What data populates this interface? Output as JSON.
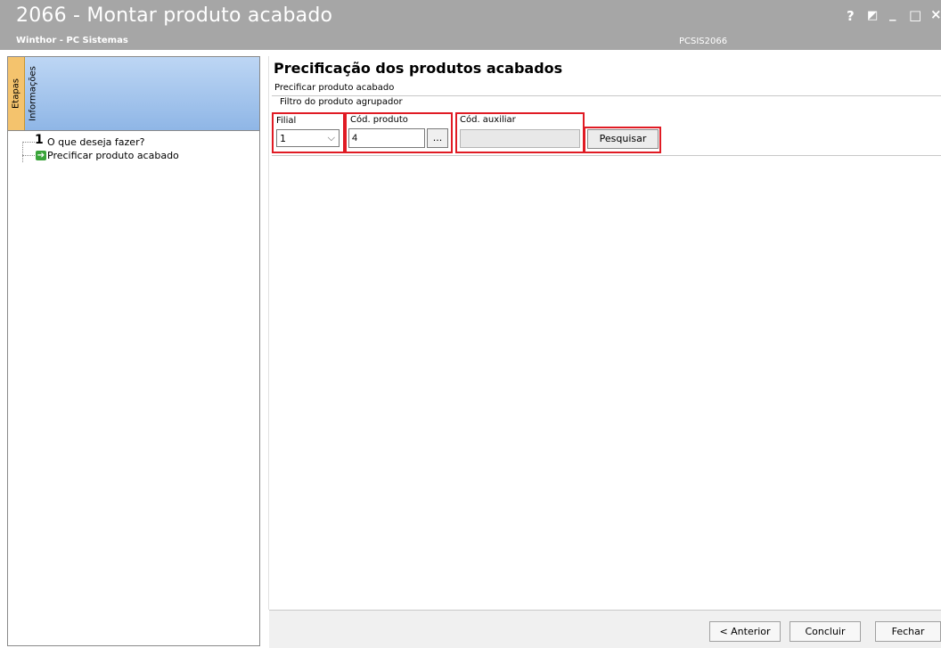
{
  "window": {
    "title": "2066 - Montar produto acabado",
    "subtitle": "Winthor - PC Sistemas",
    "program_code": "PCSIS2066",
    "controls": {
      "help": "?",
      "restore": "◩",
      "minimize": "_",
      "maximize": "□",
      "close": "×"
    }
  },
  "sidebar": {
    "tabs": [
      {
        "label": "Etapas"
      },
      {
        "label": "Informações"
      }
    ],
    "steps": [
      {
        "number": "1",
        "label": "O que deseja fazer?"
      },
      {
        "icon": "arrow-right-icon",
        "label": "Precificar produto acabado"
      }
    ]
  },
  "main": {
    "title": "Precificação dos produtos acabados",
    "subtitle": "Precificar produto acabado",
    "filter": {
      "legend": "Filtro do produto agrupador",
      "filial_label": "Filial",
      "filial_value": "1",
      "cod_produto_label": "Cód. produto",
      "cod_produto_value": "4",
      "ellipsis_label": "...",
      "cod_auxiliar_label": "Cód. auxiliar",
      "cod_auxiliar_value": "",
      "search_label": "Pesquisar"
    },
    "highlight_color": "#e01b24"
  },
  "footer": {
    "previous_label": "< Anterior",
    "finish_label": "Concluir",
    "close_label": "Fechar"
  }
}
